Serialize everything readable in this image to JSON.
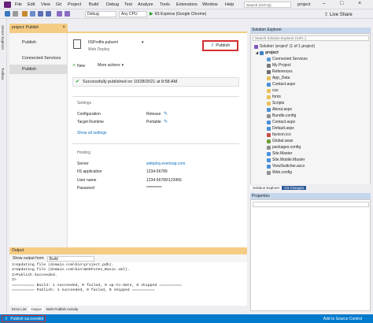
{
  "menubar": {
    "items": [
      "File",
      "Edit",
      "View",
      "Git",
      "Project",
      "Build",
      "Debug",
      "Test",
      "Analyze",
      "Tools",
      "Extensions",
      "Window",
      "Help"
    ],
    "search_placeholder": "Search (Ctrl+Q)",
    "window_title": "project"
  },
  "toolbar": {
    "config": "Debug",
    "platform": "Any CPU",
    "run_label": "IIS Express (Google Chrome)",
    "live_share": "Live Share"
  },
  "left_strip": [
    "Server Explorer",
    "Toolbox"
  ],
  "doc_tab": "project: Publish",
  "publish_nav": [
    "Publish",
    "Connected Services",
    "Publish"
  ],
  "profile": {
    "file_name": "IISProfile.pubxml",
    "sub_label": "Web Deploy",
    "publish_button": "Publish",
    "new_label": "New",
    "more_actions": "More actions",
    "success_msg": "Successfully published on 10/28/2021 at 8:58 AM."
  },
  "settings": {
    "heading": "Settings",
    "configuration_label": "Configuration",
    "configuration_value": "Release",
    "runtime_label": "Target Runtime",
    "runtime_value": "Portable",
    "show_all": "Show all settings"
  },
  "hosting": {
    "heading": "Hosting",
    "server_label": "Server",
    "server_value": "wdeploy.everleap.com",
    "iis_label": "IIS application",
    "iis_value": "1234-56789",
    "user_label": "User name",
    "user_value": "1234-56789\\123456",
    "password_label": "Password",
    "password_value": "**********"
  },
  "solution_explorer": {
    "title": "Solution Explorer",
    "search_placeholder": "Search Solution Explorer (Ctrl+;)",
    "solution_label": "Solution 'project' (1 of 1 project)",
    "project": "project",
    "items": [
      "Connected Services",
      "My Project",
      "References",
      "App_Data",
      "Contact.aspx",
      "css",
      "fonts",
      "Scripts",
      "About.aspx",
      "Bundle.config",
      "Contact.aspx",
      "Default.aspx",
      "favicon.ico",
      "Global.asax",
      "packages.config",
      "Site.Master",
      "Site.Mobile.Master",
      "ViewSwitcher.ascx",
      "Web.config"
    ],
    "tabs": [
      "Solution Explorer",
      "Git Changes"
    ]
  },
  "properties": {
    "title": "Properties"
  },
  "output": {
    "title": "Output",
    "show_from_label": "Show output from:",
    "show_from_value": "Build",
    "lines": [
      "1>Updating file (domain.com\\bin\\project.pdb).",
      "2>Updating file (domain.com\\bin\\WebForms_Basic.xml).",
      "2>Publish Succeeded.",
      "2>",
      "========== Build: 1 succeeded, 0 failed, 0 up-to-date, 0 skipped ==========",
      "========== Publish: 1 succeeded, 0 failed, 0 skipped ==========",
      ""
    ],
    "tabs": [
      "Error List",
      "Output",
      "Web Publish Activity"
    ]
  },
  "status": {
    "left": "Publish succeeded",
    "right": "Add to Source Control"
  },
  "colors": {
    "accent": "#007acc",
    "highlight": "#d32f2f",
    "tab": "#f5cc84"
  }
}
